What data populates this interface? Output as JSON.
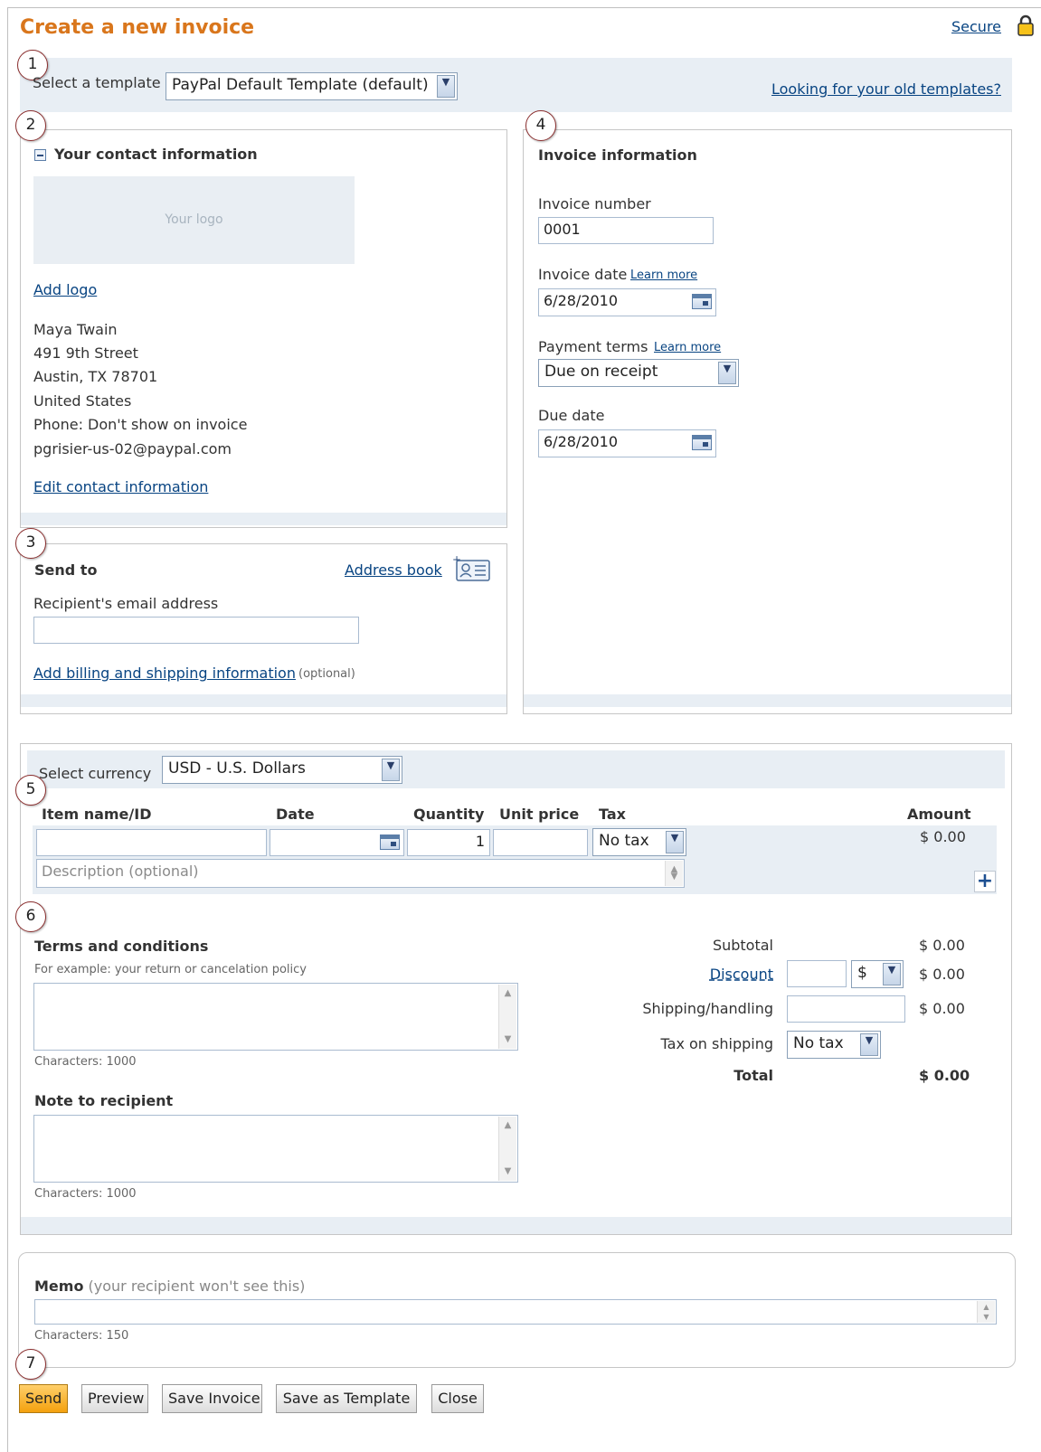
{
  "header": {
    "title": "Create a new invoice",
    "secure_label": "Secure",
    "lock_icon": "lock-icon"
  },
  "template_bar": {
    "label": "Select a template",
    "selected": "PayPal Default Template (default)",
    "old_templates_link": "Looking for your old templates?"
  },
  "badges": [
    "1",
    "2",
    "3",
    "4",
    "5",
    "6",
    "7"
  ],
  "contact": {
    "heading": "Your contact information",
    "collapse_icon": "minus-square-icon",
    "logo_placeholder": "Your logo",
    "add_logo": "Add logo",
    "lines": [
      "Maya Twain",
      "491 9th Street",
      "Austin, TX 78701",
      "United States",
      "Phone: Don't show on invoice",
      "pgrisier-us-02@paypal.com"
    ],
    "edit_link": "Edit contact information"
  },
  "send_to": {
    "heading": "Send to",
    "address_book": "Address book",
    "address_book_icon": "address-book-icon",
    "email_label": "Recipient's email address",
    "email_value": "",
    "billing_link": "Add billing and shipping information",
    "optional": "(optional)"
  },
  "invoice_info": {
    "heading": "Invoice information",
    "number_label": "Invoice number",
    "number_value": "0001",
    "date_label": "Invoice date",
    "learn_more": "Learn more",
    "date_value": "6/28/2010",
    "terms_label": "Payment terms",
    "terms_value": "Due on receipt",
    "due_label": "Due date",
    "due_value": "6/28/2010"
  },
  "items": {
    "currency_label": "Select currency",
    "currency_value": "USD - U.S. Dollars",
    "headers": {
      "item": "Item name/ID",
      "date": "Date",
      "quantity": "Quantity",
      "unit_price": "Unit price",
      "tax": "Tax",
      "amount": "Amount"
    },
    "row": {
      "item": "",
      "date": "",
      "quantity": "1",
      "unit_price": "",
      "tax": "No tax",
      "amount": "$ 0.00"
    },
    "description_placeholder": "Description (optional)",
    "add_icon": "plus-icon"
  },
  "terms": {
    "heading": "Terms and conditions",
    "hint": "For example: your return or cancelation policy",
    "chars": "Characters: 1000",
    "note_heading": "Note to recipient",
    "note_chars": "Characters: 1000"
  },
  "totals": {
    "subtotal_label": "Subtotal",
    "subtotal_value": "$ 0.00",
    "discount_label": "Discount",
    "discount_unit": "$",
    "discount_value": "$ 0.00",
    "shipping_label": "Shipping/handling",
    "shipping_value": "$ 0.00",
    "tax_shipping_label": "Tax on shipping",
    "tax_shipping_value": "No tax",
    "total_label": "Total",
    "total_value": "$ 0.00"
  },
  "memo": {
    "label": "Memo",
    "hint": "(your recipient won't see this)",
    "chars": "Characters: 150"
  },
  "actions": {
    "send": "Send",
    "preview": "Preview",
    "save_invoice": "Save Invoice",
    "save_template": "Save as Template",
    "close": "Close"
  },
  "colors": {
    "title": "#d9761c",
    "link": "#084482",
    "bar": "#e8eef4",
    "badge_border": "#8b2f2f",
    "send_button": "#f4a10e"
  }
}
